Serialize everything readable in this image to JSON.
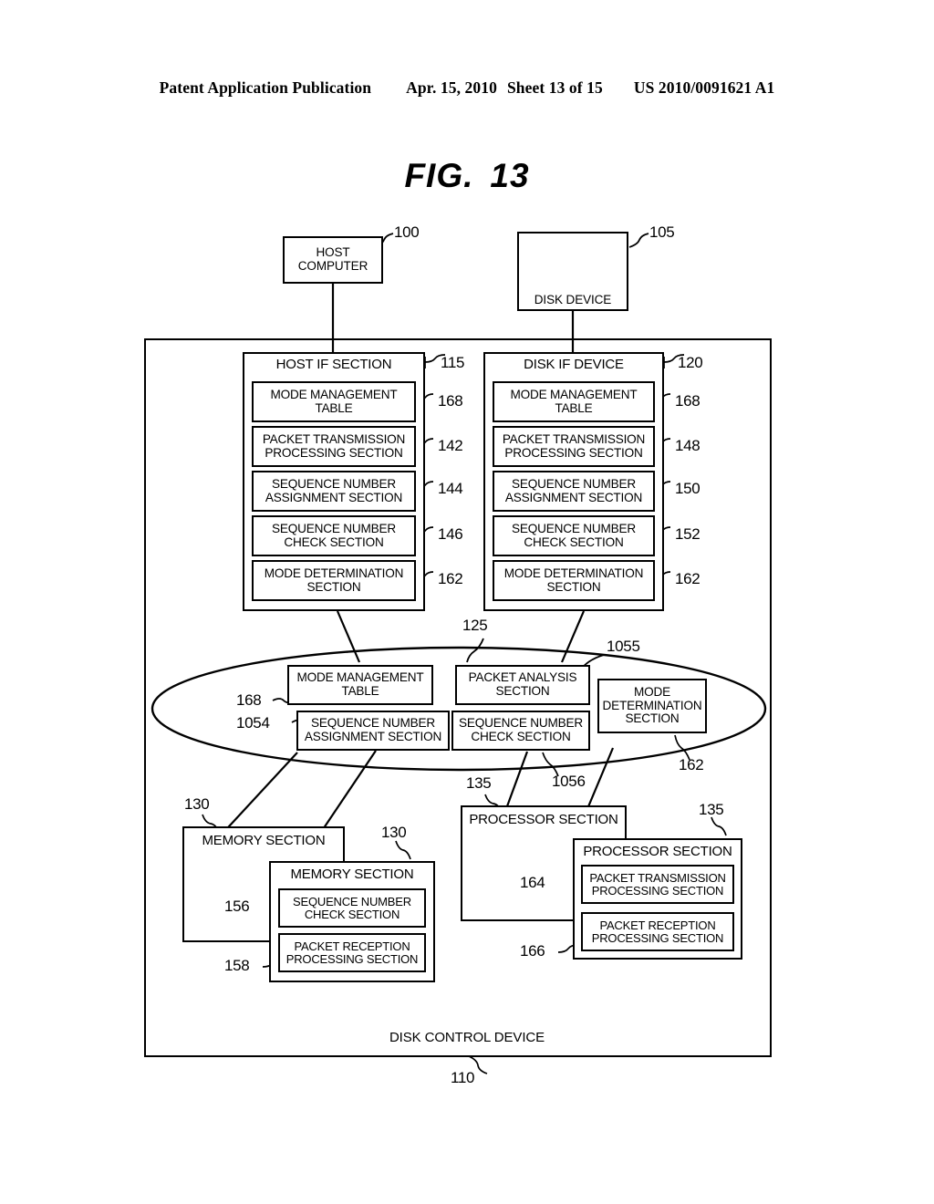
{
  "header": {
    "left": "Patent Application Publication",
    "date": "Apr. 15, 2010",
    "sheet": "Sheet 13 of 15",
    "patent_number": "US 2010/0091621 A1"
  },
  "figure": {
    "label": "FIG.",
    "number": "13"
  },
  "top_nodes": {
    "host_computer": {
      "line1": "HOST",
      "line2": "COMPUTER",
      "ref": "100"
    },
    "disk_device": {
      "label": "DISK DEVICE",
      "ref": "105"
    }
  },
  "host_if_section": {
    "title": "HOST IF SECTION",
    "ref": "115",
    "items": [
      {
        "line1": "MODE MANAGEMENT",
        "line2": "TABLE",
        "ref": "168"
      },
      {
        "line1": "PACKET TRANSMISSION",
        "line2": "PROCESSING SECTION",
        "ref": "142"
      },
      {
        "line1": "SEQUENCE NUMBER",
        "line2": "ASSIGNMENT SECTION",
        "ref": "144"
      },
      {
        "line1": "SEQUENCE NUMBER",
        "line2": "CHECK SECTION",
        "ref": "146"
      },
      {
        "line1": "MODE DETERMINATION",
        "line2": "SECTION",
        "ref": "162"
      }
    ]
  },
  "disk_if_device": {
    "title": "DISK IF DEVICE",
    "ref": "120",
    "items": [
      {
        "line1": "MODE MANAGEMENT",
        "line2": "TABLE",
        "ref": "168"
      },
      {
        "line1": "PACKET TRANSMISSION",
        "line2": "PROCESSING SECTION",
        "ref": "148"
      },
      {
        "line1": "SEQUENCE NUMBER",
        "line2": "ASSIGNMENT SECTION",
        "ref": "150"
      },
      {
        "line1": "SEQUENCE NUMBER",
        "line2": "CHECK SECTION",
        "ref": "152"
      },
      {
        "line1": "MODE DETERMINATION",
        "line2": "SECTION",
        "ref": "162"
      }
    ]
  },
  "switch_ellipse": {
    "ref": "125",
    "boxes": {
      "mode_management_table": {
        "line1": "MODE MANAGEMENT",
        "line2": "TABLE",
        "ref": "168"
      },
      "sequence_number_assignment": {
        "line1": "SEQUENCE NUMBER",
        "line2": "ASSIGNMENT SECTION",
        "ref": "1054"
      },
      "packet_analysis": {
        "line1": "PACKET ANALYSIS",
        "line2": "SECTION",
        "ref": "1055"
      },
      "sequence_number_check": {
        "line1": "SEQUENCE NUMBER",
        "line2": "CHECK SECTION",
        "ref": "1056"
      },
      "mode_determination": {
        "line1": "MODE",
        "line2": "DETERMINATION",
        "line3": "SECTION",
        "ref": "162"
      }
    }
  },
  "memory_back": {
    "title": "MEMORY SECTION",
    "ref": "130"
  },
  "memory_front": {
    "title": "MEMORY SECTION",
    "ref": "130",
    "items": [
      {
        "line1": "SEQUENCE NUMBER",
        "line2": "CHECK SECTION",
        "ref": "156"
      },
      {
        "line1": "PACKET RECEPTION",
        "line2": "PROCESSING SECTION",
        "ref": "158"
      }
    ]
  },
  "processor_back": {
    "title": "PROCESSOR SECTION",
    "ref": "135"
  },
  "processor_front": {
    "title": "PROCESSOR SECTION",
    "ref": "135",
    "items": [
      {
        "line1": "PACKET TRANSMISSION",
        "line2": "PROCESSING SECTION",
        "ref": "164"
      },
      {
        "line1": "PACKET RECEPTION",
        "line2": "PROCESSING SECTION",
        "ref": "166"
      }
    ]
  },
  "outer_container": {
    "label": "DISK CONTROL DEVICE",
    "ref": "110"
  }
}
